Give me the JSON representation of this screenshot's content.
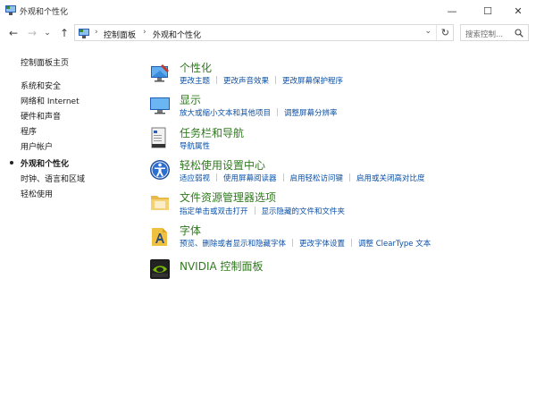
{
  "window": {
    "title": "外观和个性化",
    "minimize": "—",
    "maximize": "☐",
    "close": "✕"
  },
  "nav": {
    "back": "←",
    "forward": "→",
    "dropdown": "⌄",
    "up": "↑"
  },
  "address": {
    "separator": "›",
    "crumbs": [
      "控制面板",
      "外观和个性化"
    ],
    "dropdown": "⌄",
    "refresh": "↻"
  },
  "search": {
    "placeholder": "搜索控制..."
  },
  "sidebar": {
    "items": [
      {
        "label": "控制面板主页"
      },
      {
        "label": "系统和安全"
      },
      {
        "label": "网络和 Internet"
      },
      {
        "label": "硬件和声音"
      },
      {
        "label": "程序"
      },
      {
        "label": "用户帐户"
      },
      {
        "label": "外观和个性化",
        "active": true
      },
      {
        "label": "时钟、语言和区域"
      },
      {
        "label": "轻松使用"
      }
    ]
  },
  "categories": [
    {
      "icon": "personalization-icon",
      "title": "个性化",
      "links": [
        "更改主题",
        "更改声音效果",
        "更改屏幕保护程序"
      ]
    },
    {
      "icon": "display-icon",
      "title": "显示",
      "links": [
        "放大或缩小文本和其他项目",
        "调整屏幕分辨率"
      ]
    },
    {
      "icon": "taskbar-icon",
      "title": "任务栏和导航",
      "links": [
        "导航属性"
      ]
    },
    {
      "icon": "ease-of-access-icon",
      "title": "轻松使用设置中心",
      "links": [
        "适应弱视",
        "使用屏幕阅读器",
        "启用轻松访问键",
        "启用或关闭高对比度"
      ]
    },
    {
      "icon": "folder-options-icon",
      "title": "文件资源管理器选项",
      "links": [
        "指定单击或双击打开",
        "显示隐藏的文件和文件夹"
      ]
    },
    {
      "icon": "fonts-icon",
      "title": "字体",
      "links": [
        "预览、删除或者显示和隐藏字体",
        "更改字体设置",
        "调整 ClearType 文本"
      ]
    },
    {
      "icon": "nvidia-icon",
      "title": "NVIDIA 控制面板",
      "links": []
    }
  ]
}
